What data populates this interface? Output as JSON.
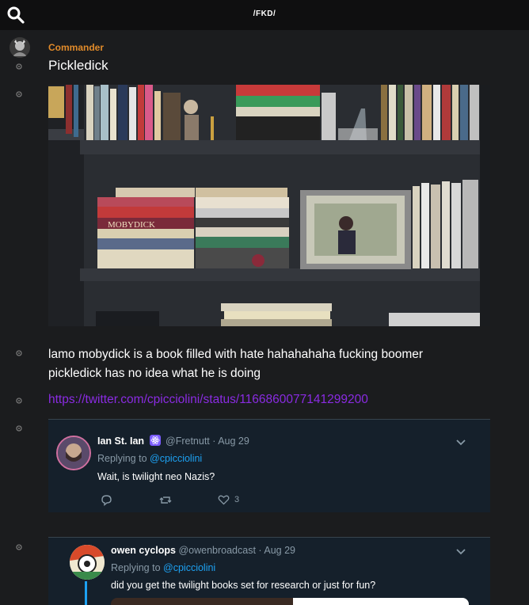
{
  "header": {
    "board": "/FKD/",
    "search_icon": "search-icon"
  },
  "post": {
    "author": "Commander",
    "title": "Pickledick",
    "body": "lamo mobydick is a book filled with hate hahahahaha fucking boomer pickledick has no idea what he is doing",
    "link": "https://twitter.com/cpicciolini/status/1166860077141299200",
    "image": {
      "book_spine_text": "MOBYDICK"
    }
  },
  "tweets": [
    {
      "name": "Ian St. Ian",
      "handle": "@Fretnutt",
      "date": "· Aug 29",
      "replying_label": "Replying to",
      "replying_handle": "@cpicciolini",
      "text": "Wait, is twilight neo Nazis?",
      "like_count": "3"
    },
    {
      "name": "owen cyclops",
      "handle": "@owenbroadcast",
      "date": "· Aug 29",
      "replying_label": "Replying to",
      "replying_handle": "@cpicciolini",
      "text": "did you get the twilight books set for research or just for fun?"
    }
  ],
  "colors": {
    "author": "#e08a2a",
    "link": "#8a2be2",
    "tweet_bg": "#15202b",
    "twitter_blue": "#1da1f2"
  }
}
